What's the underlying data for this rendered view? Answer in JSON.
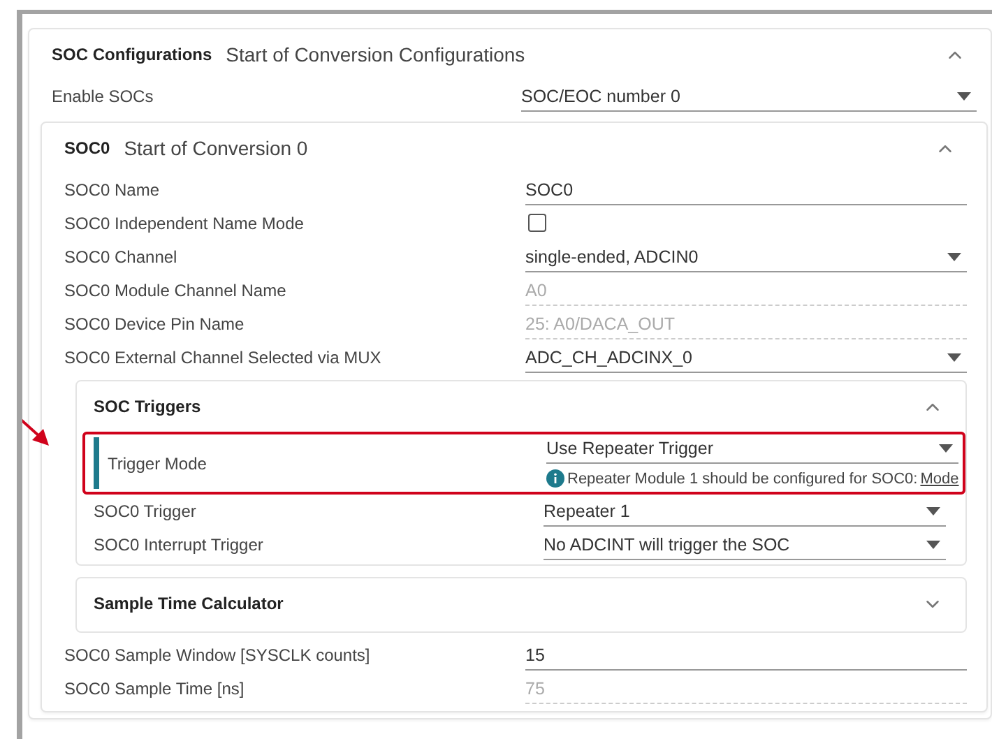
{
  "section": {
    "title": "SOC Configurations",
    "subtitle": "Start of Conversion Configurations",
    "expanded": true,
    "rows": [
      {
        "kind": "dropdown",
        "label": "Enable SOCs",
        "value": "SOC/EOC number 0"
      }
    ],
    "subsection": {
      "title": "SOC0",
      "subtitle": "Start of Conversion 0",
      "expanded": true,
      "items": [
        {
          "kind": "text",
          "label": "SOC0 Name",
          "value": "SOC0"
        },
        {
          "kind": "checkbox",
          "label": "SOC0 Independent Name Mode",
          "checked": false
        },
        {
          "kind": "dropdown",
          "label": "SOC0 Channel",
          "value": "single-ended, ADCIN0"
        },
        {
          "kind": "readonly",
          "label": "SOC0 Module Channel Name",
          "value": "A0"
        },
        {
          "kind": "readonly",
          "label": "SOC0 Device Pin Name",
          "value": "25: A0/DACA_OUT"
        },
        {
          "kind": "dropdown",
          "label": "SOC0 External Channel Selected via MUX",
          "value": "ADC_CH_ADCINX_0"
        },
        {
          "kind": "group",
          "title": "SOC Triggers",
          "expanded": true,
          "rows": [
            {
              "kind": "dropdown",
              "label": "Trigger Mode",
              "value": "Use Repeater Trigger",
              "highlighted": true,
              "annotated": true,
              "note": "Repeater Module 1 should be configured for SOC0:",
              "note_link": "Mode"
            },
            {
              "kind": "dropdown",
              "label": "SOC0 Trigger",
              "value": "Repeater 1"
            },
            {
              "kind": "dropdown",
              "label": "SOC0 Interrupt Trigger",
              "value": "No ADCINT will trigger the SOC"
            }
          ]
        },
        {
          "kind": "group",
          "title": "Sample Time Calculator",
          "expanded": false
        },
        {
          "kind": "text",
          "label": "SOC0 Sample Window [SYSCLK counts]",
          "value": "15"
        },
        {
          "kind": "readonly",
          "label": "SOC0 Sample Time [ns]",
          "value": "75"
        }
      ]
    }
  }
}
